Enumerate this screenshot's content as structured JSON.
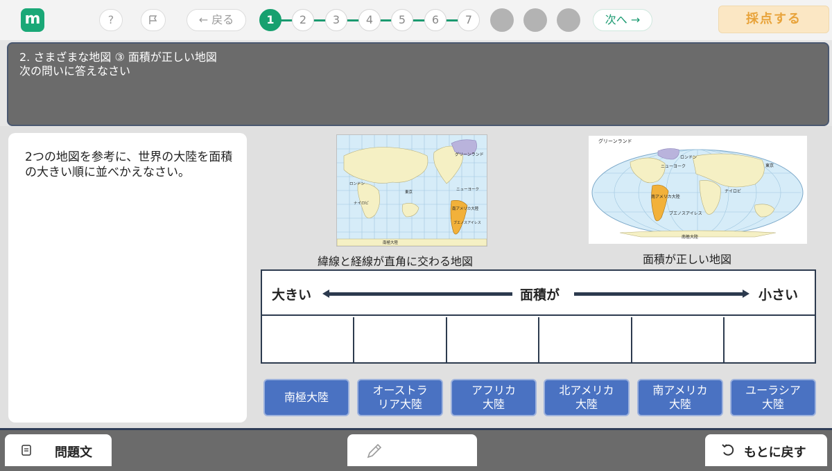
{
  "header": {
    "logo": "m",
    "help": "?",
    "back": "← 戻る",
    "steps": [
      "1",
      "2",
      "3",
      "4",
      "5",
      "6",
      "7"
    ],
    "next": "次へ →",
    "grade": "採点する"
  },
  "question": {
    "title": "2. さまざまな地図 ③ 面積が正しい地図",
    "subtitle": "次の問いに答えなさい"
  },
  "left": {
    "text": "2つの地図を参考に、世界の大陸を面積の大きい順に並べかえなさい。"
  },
  "maps": {
    "map1_caption": "緯線と経線が直角に交わる地図",
    "map2_caption": "面積が正しい地図",
    "map1_labels": {
      "greenland": "グリーンランド",
      "london": "ロンドン",
      "tokyo": "東京",
      "newyork": "ニューヨーク",
      "nairobi": "ナイロビ",
      "south_america": "南アメリカ大陸",
      "buenos": "ブエノスアイレス",
      "antarctica": "南極大陸"
    },
    "map2_labels": {
      "greenland": "グリーンランド",
      "london": "ロンドン",
      "newyork": "ニューヨーク",
      "tokyo": "東京",
      "nairobi": "ナイロビ",
      "south_america": "南アメリカ大陸",
      "buenos": "ブエノスアイレス",
      "antarctica": "南極大陸"
    }
  },
  "table": {
    "left": "大きい",
    "mid": "面積が",
    "right": "小さい"
  },
  "choices": [
    "南極大陸",
    "オーストラ\nリア大陸",
    "アフリカ\n大陸",
    "北アメリカ\n大陸",
    "南アメリカ\n大陸",
    "ユーラシア\n大陸"
  ],
  "footer": {
    "problem": "問題文",
    "undo": "もとに戻す"
  },
  "colors": {
    "accent": "#17a06f",
    "choice": "#4a72c2",
    "grade": "#e8a33a"
  }
}
